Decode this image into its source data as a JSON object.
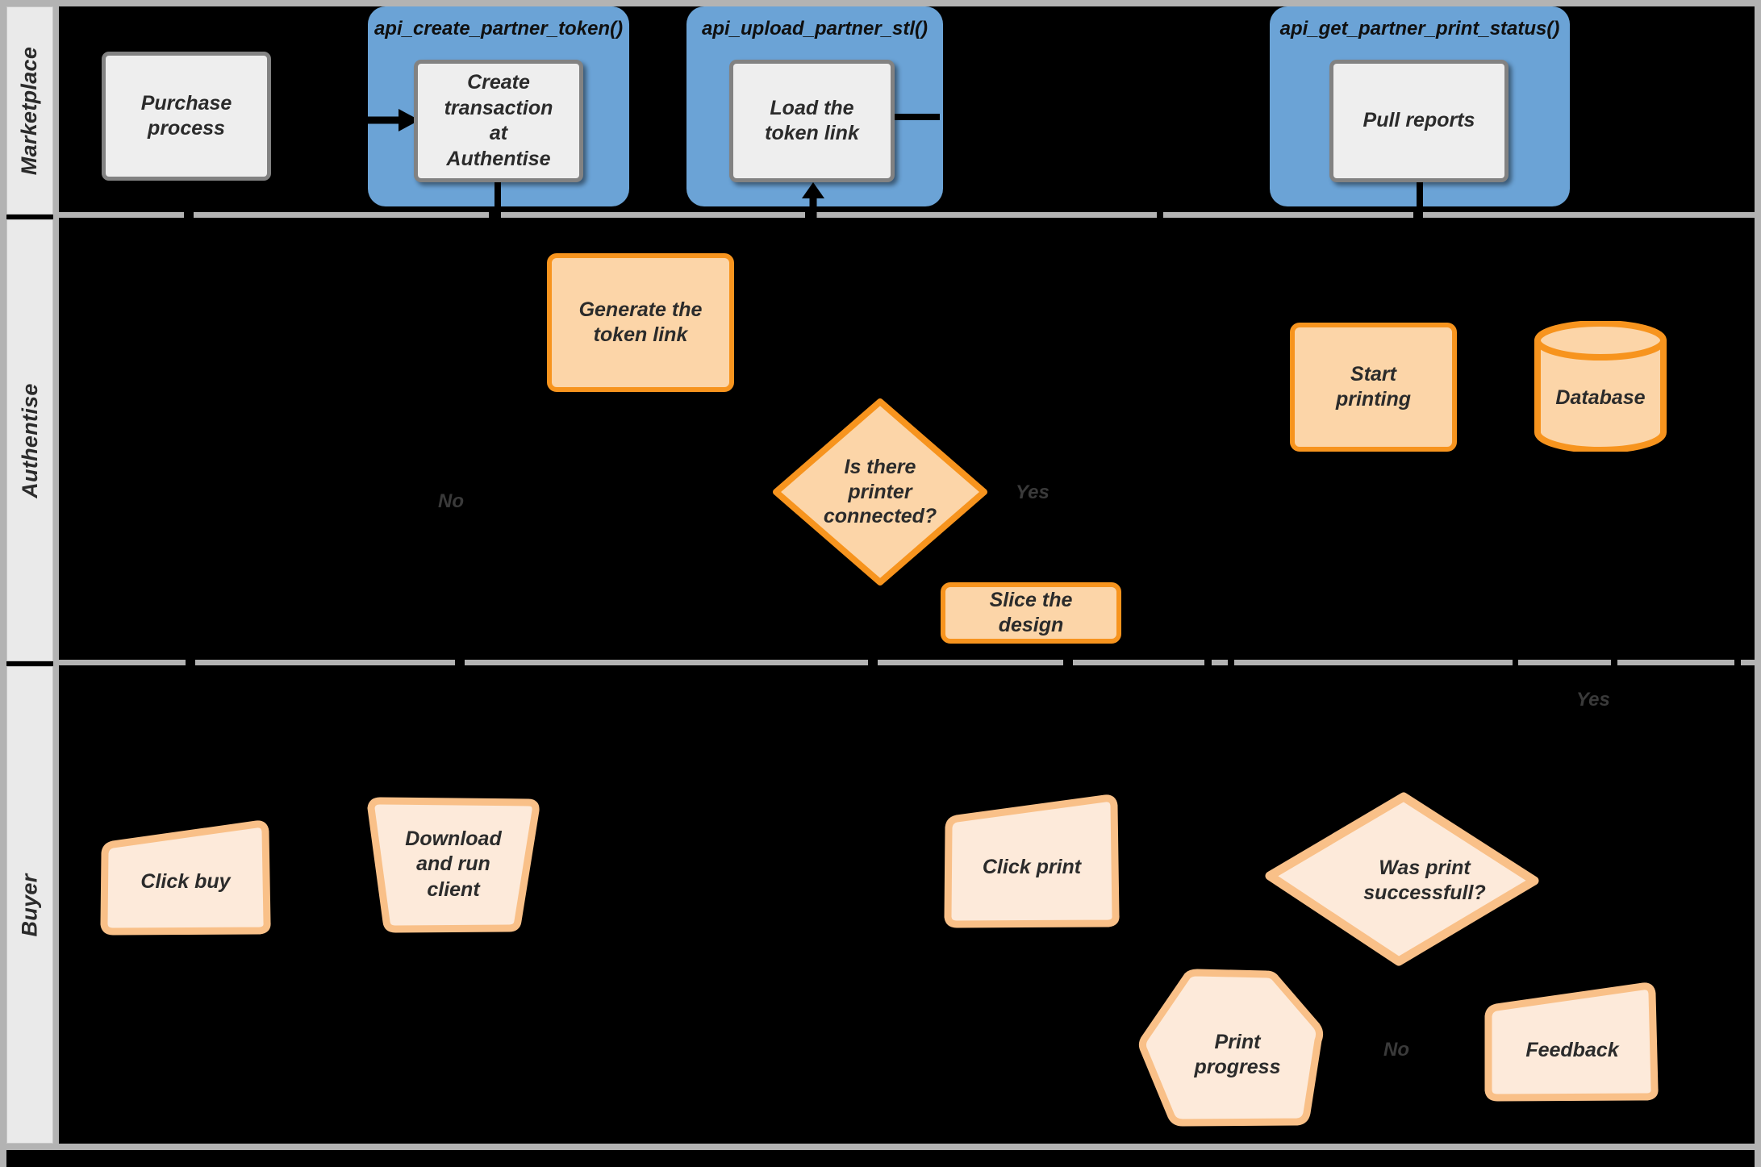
{
  "diagram": {
    "title": "Marketplace / Authentise / Buyer 3D printing swimlane flow",
    "colors": {
      "background": "#000000",
      "lane_header_fill": "#eaeaea",
      "lane_rule": "#b3b3b3",
      "api_phase_fill": "#6ba3d6",
      "process_grey_fill": "#eeeeee",
      "process_grey_border": "#828282",
      "orange_fill": "#fcd5a8",
      "orange_border": "#f7941e",
      "sketch_fill": "#fdeada",
      "sketch_border": "#f9c088",
      "text": "#2b2b2b",
      "edge_label": "#3a3a3a"
    }
  },
  "lanes": [
    {
      "id": "marketplace",
      "label": "Marketplace"
    },
    {
      "id": "authentise",
      "label": "Authentise"
    },
    {
      "id": "buyer",
      "label": "Buyer"
    }
  ],
  "api_phases": [
    {
      "id": "api-create-partner-token",
      "label": "api_create_partner_token()"
    },
    {
      "id": "api-upload-partner-stl",
      "label": "api_upload_partner_stl()"
    },
    {
      "id": "api-get-partner-print-status",
      "label": "api_get_partner_print_status()"
    }
  ],
  "marketplace_nodes": [
    {
      "id": "purchase-process",
      "label": "Purchase\nprocess"
    },
    {
      "id": "create-transaction",
      "label": "Create\ntransaction\nat\nAuthentise"
    },
    {
      "id": "load-token-link",
      "label": "Load the\ntoken link"
    },
    {
      "id": "pull-reports",
      "label": "Pull reports"
    }
  ],
  "authentise_nodes": [
    {
      "id": "generate-token-link",
      "label": "Generate the\ntoken link",
      "shape": "box"
    },
    {
      "id": "is-printer-connected",
      "label": "Is there\nprinter\nconnected?",
      "shape": "diamond"
    },
    {
      "id": "slice-the-design",
      "label": "Slice the\ndesign",
      "shape": "box"
    },
    {
      "id": "start-printing",
      "label": "Start\nprinting",
      "shape": "box"
    },
    {
      "id": "database",
      "label": "Database",
      "shape": "cylinder"
    }
  ],
  "buyer_nodes": [
    {
      "id": "click-buy",
      "label": "Click buy",
      "shape": "sketch-rect"
    },
    {
      "id": "download-run-client",
      "label": "Download\nand run\nclient",
      "shape": "sketch-trapezoid"
    },
    {
      "id": "click-print",
      "label": "Click print",
      "shape": "sketch-rect"
    },
    {
      "id": "was-print-successful",
      "label": "Was print\nsuccessfull?",
      "shape": "sketch-diamond"
    },
    {
      "id": "print-progress",
      "label": "Print\nprogress",
      "shape": "sketch-hexagon"
    },
    {
      "id": "feedback",
      "label": "Feedback",
      "shape": "sketch-rect"
    }
  ],
  "edge_labels": [
    {
      "id": "edge-label-no-printer",
      "text": "No"
    },
    {
      "id": "edge-label-yes-printer",
      "text": "Yes"
    },
    {
      "id": "edge-label-yes-print",
      "text": "Yes"
    },
    {
      "id": "edge-label-no-print",
      "text": "No"
    }
  ]
}
